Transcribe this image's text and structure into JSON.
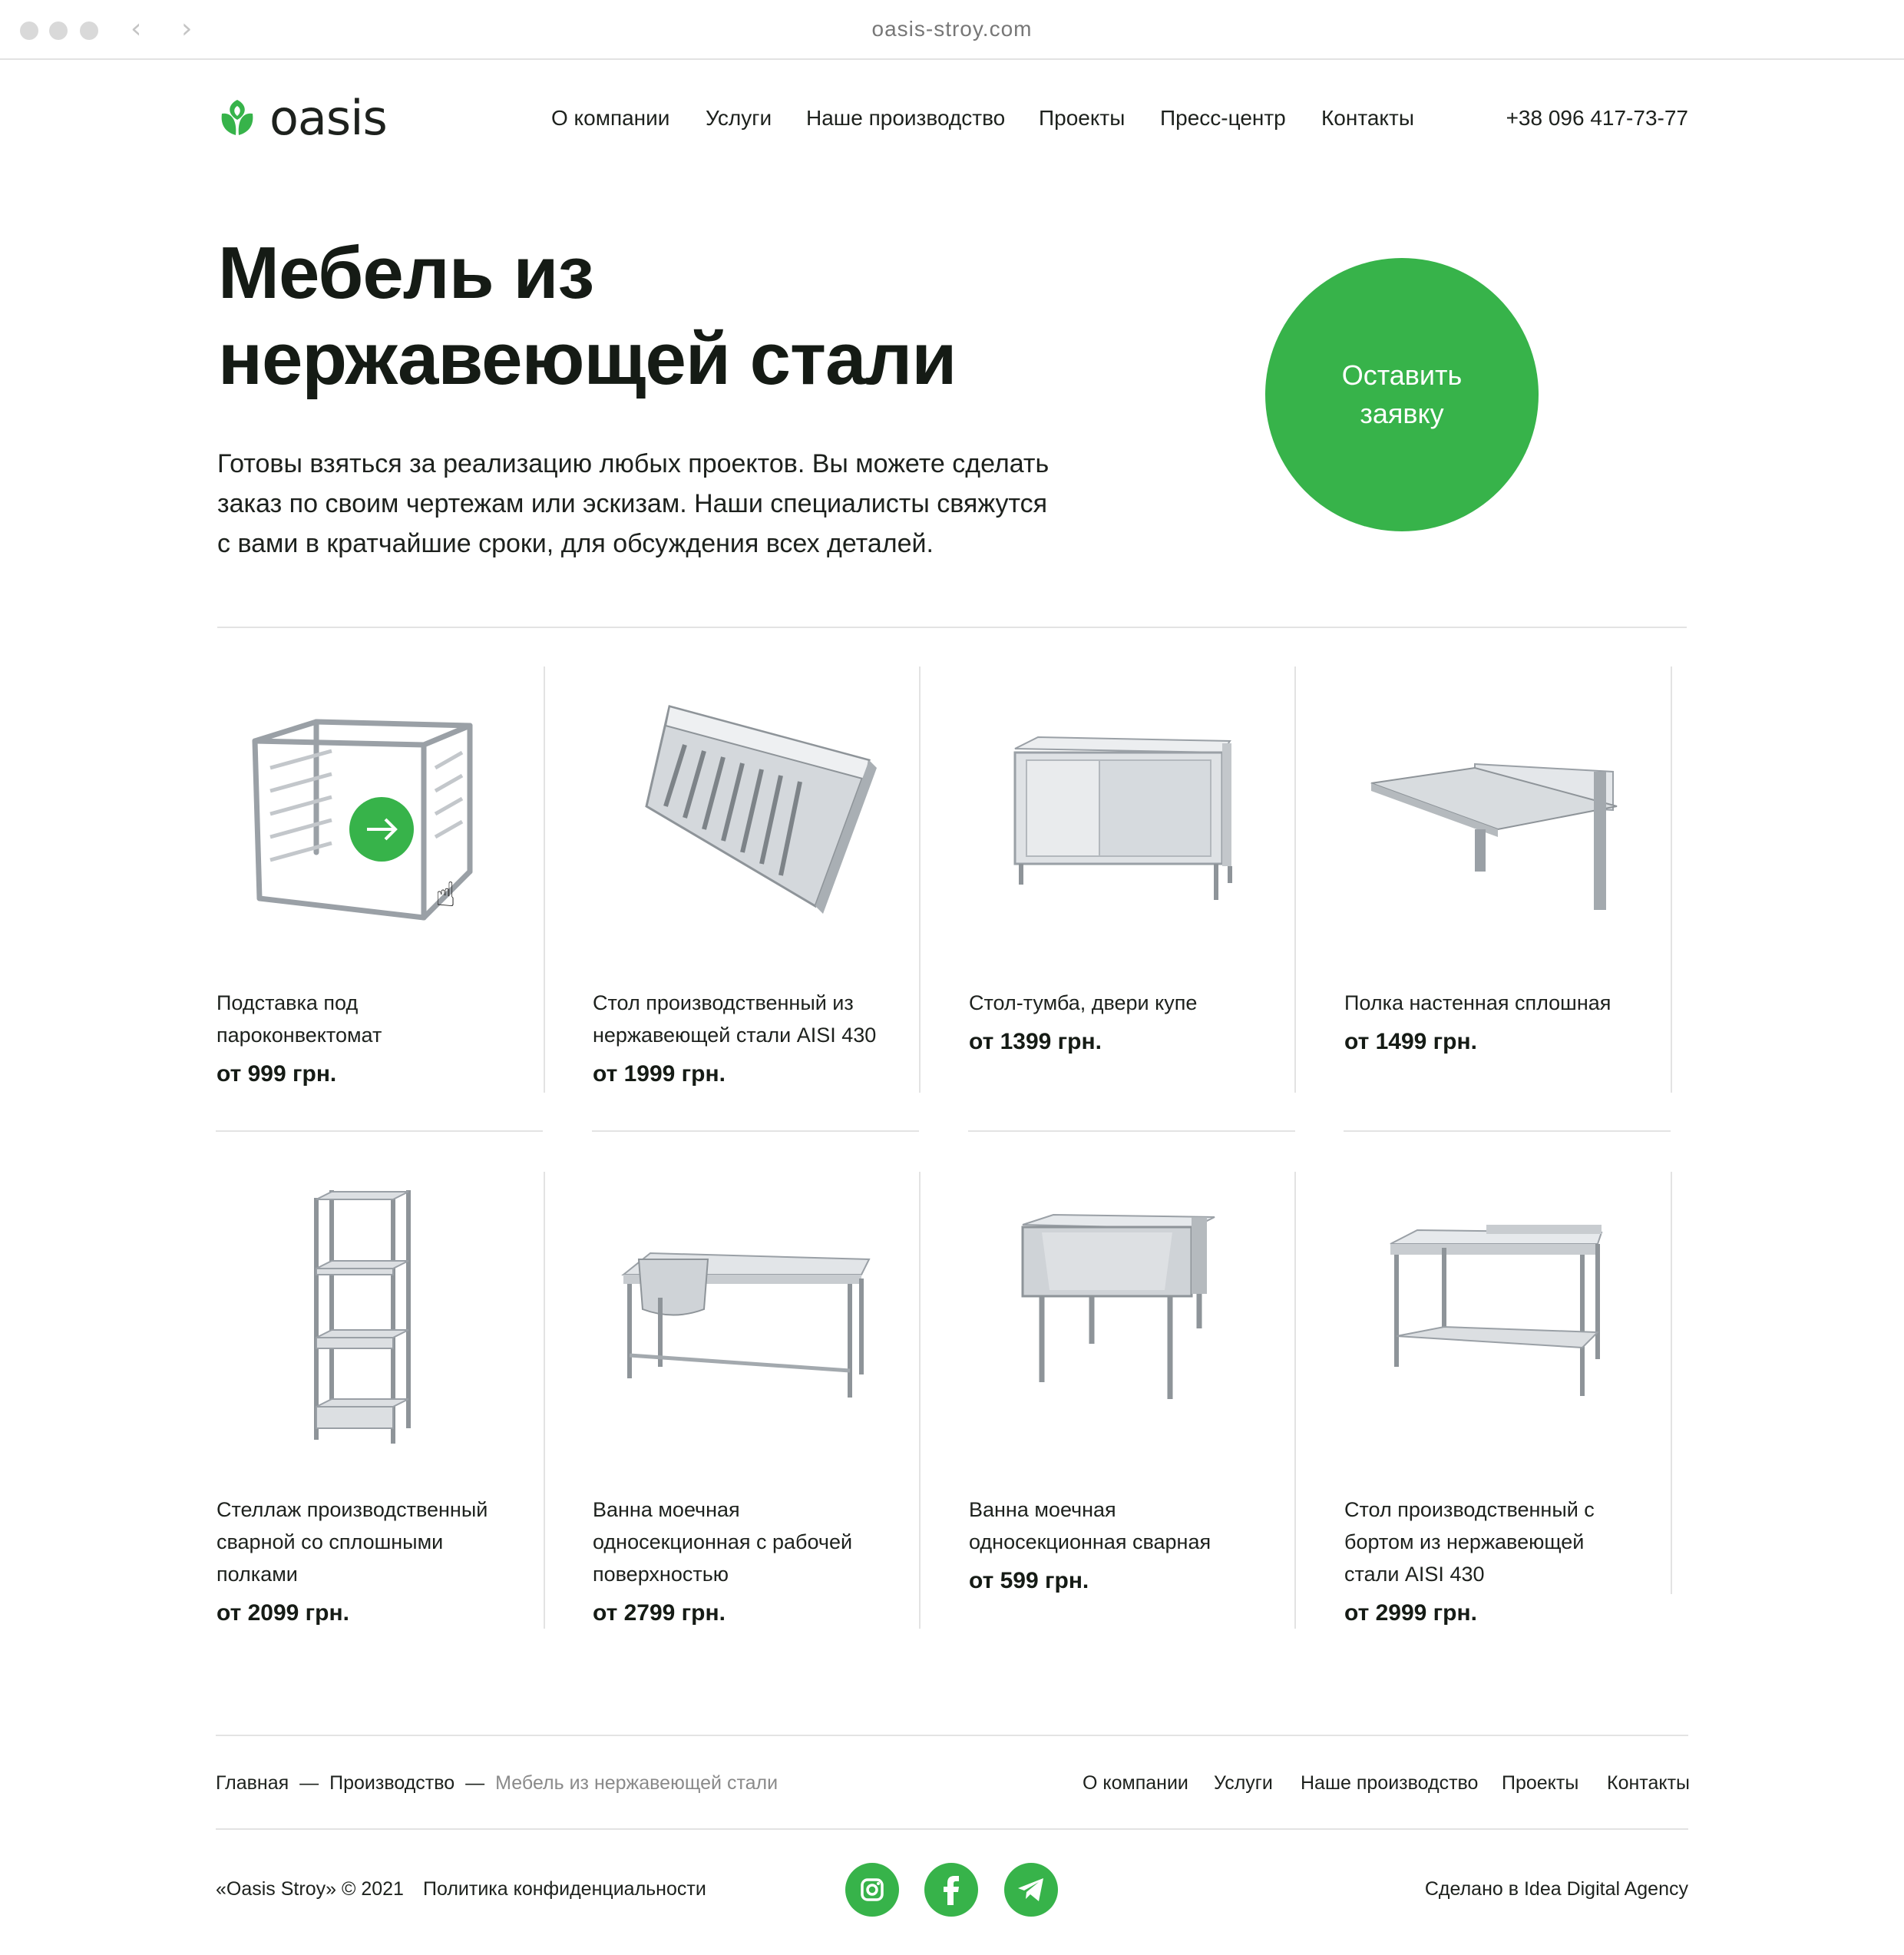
{
  "browser": {
    "url": "oasis-stroy.com"
  },
  "header": {
    "logo_text": "oasis",
    "nav": [
      "О компании",
      "Услуги",
      "Наше производство",
      "Проекты",
      "Пресс-центр",
      "Контакты"
    ],
    "phone": "+38 096 417-73-77"
  },
  "hero": {
    "title_line1": "Мебель из",
    "title_line2": "нержавеющей стали",
    "text_line1": "Готовы взяться за реализацию любых проектов. Вы можете сделать",
    "text_line2": "заказ по своим чертежам или эскизам. Наши специалисты свяжутся",
    "text_line3": "с вами в кратчайшие сроки, для обсуждения всех деталей.",
    "cta_line1": "Оставить",
    "cta_line2": "заявку"
  },
  "products": [
    {
      "name_lines": [
        "Подставка под",
        "пароконвектомат"
      ],
      "price": "от 999 грн.",
      "icon": "stand-rack-image"
    },
    {
      "name_lines": [
        "Стол производственный из",
        "нержавеющей стали AISI 430"
      ],
      "price": "от 1999 грн.",
      "icon": "exhaust-hood-image"
    },
    {
      "name_lines": [
        "Стол-тумба, двери купе"
      ],
      "price": "от 1399 грн.",
      "icon": "cabinet-table-image"
    },
    {
      "name_lines": [
        "Полка настенная сплошная"
      ],
      "price": "от 1499 грн.",
      "icon": "wall-shelf-image"
    },
    {
      "name_lines": [
        "Стеллаж производственный",
        "сварной со сплошными",
        "полками"
      ],
      "price": "от 2099 грн.",
      "icon": "shelving-rack-image"
    },
    {
      "name_lines": [
        "Ванна моечная",
        "односекционная с рабочей",
        "поверхностью"
      ],
      "price": "от 2799 грн.",
      "icon": "sink-table-image"
    },
    {
      "name_lines": [
        "Ванна моечная",
        "односекционная сварная"
      ],
      "price": "от 599 грн.",
      "icon": "single-sink-image"
    },
    {
      "name_lines": [
        "Стол производственный с",
        "бортом из нержавеющей",
        "стали AISI 430"
      ],
      "price": "от 2999 грн.",
      "icon": "work-table-image"
    }
  ],
  "footer": {
    "breadcrumbs": [
      "Главная",
      "Производство",
      "Мебель из нержавеющей стали"
    ],
    "breadcrumb_separator": "—",
    "nav": [
      "О компании",
      "Услуги",
      "Наше производство",
      "Проекты",
      "Контакты"
    ],
    "copyright": "«Oasis Stroy» © 2021",
    "policy": "Политика конфиденциальности",
    "made_by": "Сделано в Idea Digital Agency",
    "social": [
      "instagram-icon",
      "facebook-icon",
      "telegram-icon"
    ]
  },
  "colors": {
    "accent": "#37b34a",
    "text": "#1d211d",
    "divider": "#e3e3e3",
    "muted": "#8a8a8a"
  }
}
